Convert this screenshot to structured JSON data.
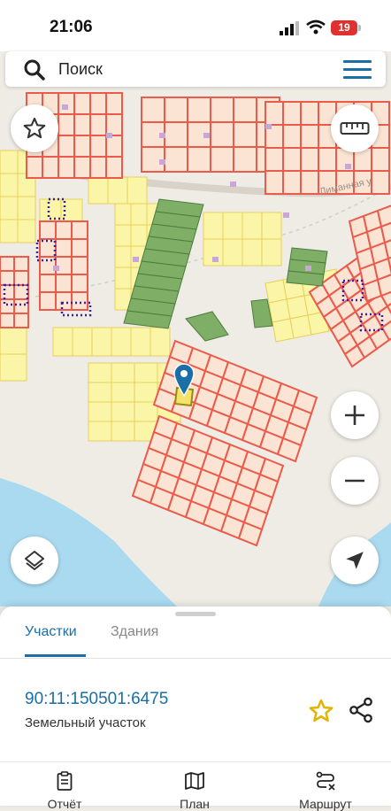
{
  "status_bar": {
    "time": "21:06",
    "battery": "19"
  },
  "search": {
    "placeholder": "Поиск"
  },
  "map": {
    "street_label": "Лиманная у"
  },
  "colors": {
    "accent": "#1a6fa6",
    "parcel_red": "#ea5b4b",
    "parcel_yellow": "#fbf5a8",
    "parcel_green": "#7fae66",
    "water": "#aadaf0",
    "favorite_star": "#e2b400"
  },
  "sheet": {
    "tabs": [
      {
        "label": "Участки",
        "active": true
      },
      {
        "label": "Здания",
        "active": false
      }
    ],
    "parcel": {
      "cadastral_number": "90:11:150501:6475",
      "type": "Земельный участок"
    }
  },
  "bottom_nav": [
    {
      "label": "Отчёт",
      "icon": "report-icon"
    },
    {
      "label": "План",
      "icon": "map-plan-icon"
    },
    {
      "label": "Маршрут",
      "icon": "route-icon"
    }
  ]
}
